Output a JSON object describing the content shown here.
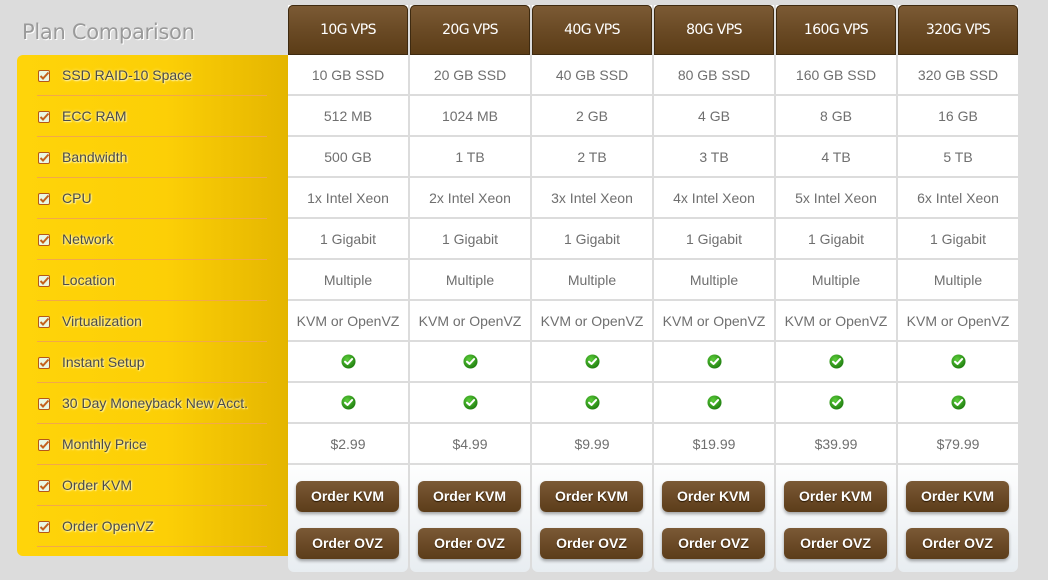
{
  "title": "Plan Comparison",
  "features": [
    "SSD RAID-10 Space",
    "ECC RAM",
    "Bandwidth",
    "CPU",
    "Network",
    "Location",
    "Virtualization",
    "Instant Setup",
    "30 Day Moneyback New Acct.",
    "Monthly Price",
    "Order KVM",
    "Order OpenVZ"
  ],
  "plans": [
    {
      "name": "10G VPS",
      "space": "10 GB SSD",
      "ram": "512 MB",
      "bandwidth": "500 GB",
      "cpu": "1x Intel Xeon",
      "network": "1 Gigabit",
      "location": "Multiple",
      "virtualization": "KVM or OpenVZ",
      "instant_setup": true,
      "moneyback": true,
      "price": "$2.99",
      "order_kvm": "Order KVM",
      "order_ovz": "Order OVZ"
    },
    {
      "name": "20G VPS",
      "space": "20 GB SSD",
      "ram": "1024 MB",
      "bandwidth": "1 TB",
      "cpu": "2x Intel Xeon",
      "network": "1 Gigabit",
      "location": "Multiple",
      "virtualization": "KVM or OpenVZ",
      "instant_setup": true,
      "moneyback": true,
      "price": "$4.99",
      "order_kvm": "Order KVM",
      "order_ovz": "Order OVZ"
    },
    {
      "name": "40G VPS",
      "space": "40 GB SSD",
      "ram": "2 GB",
      "bandwidth": "2 TB",
      "cpu": "3x Intel Xeon",
      "network": "1 Gigabit",
      "location": "Multiple",
      "virtualization": "KVM or OpenVZ",
      "instant_setup": true,
      "moneyback": true,
      "price": "$9.99",
      "order_kvm": "Order KVM",
      "order_ovz": "Order OVZ"
    },
    {
      "name": "80G VPS",
      "space": "80 GB SSD",
      "ram": "4 GB",
      "bandwidth": "3 TB",
      "cpu": "4x Intel Xeon",
      "network": "1 Gigabit",
      "location": "Multiple",
      "virtualization": "KVM or OpenVZ",
      "instant_setup": true,
      "moneyback": true,
      "price": "$19.99",
      "order_kvm": "Order KVM",
      "order_ovz": "Order OVZ"
    },
    {
      "name": "160G VPS",
      "space": "160 GB SSD",
      "ram": "8 GB",
      "bandwidth": "4 TB",
      "cpu": "5x Intel Xeon",
      "network": "1 Gigabit",
      "location": "Multiple",
      "virtualization": "KVM or OpenVZ",
      "instant_setup": true,
      "moneyback": true,
      "price": "$39.99",
      "order_kvm": "Order KVM",
      "order_ovz": "Order OVZ"
    },
    {
      "name": "320G VPS",
      "space": "320 GB SSD",
      "ram": "16 GB",
      "bandwidth": "5 TB",
      "cpu": "6x Intel Xeon",
      "network": "1 Gigabit",
      "location": "Multiple",
      "virtualization": "KVM or OpenVZ",
      "instant_setup": true,
      "moneyback": true,
      "price": "$79.99",
      "order_kvm": "Order KVM",
      "order_ovz": "Order OVZ"
    }
  ],
  "icons": {
    "feature_bullet": "checkbox-checked-icon",
    "included": "green-check-icon"
  },
  "colors": {
    "sidebar": "#fcd006",
    "header": "#6a4a25",
    "button": "#6b4a27",
    "check": "#2e9a18"
  }
}
